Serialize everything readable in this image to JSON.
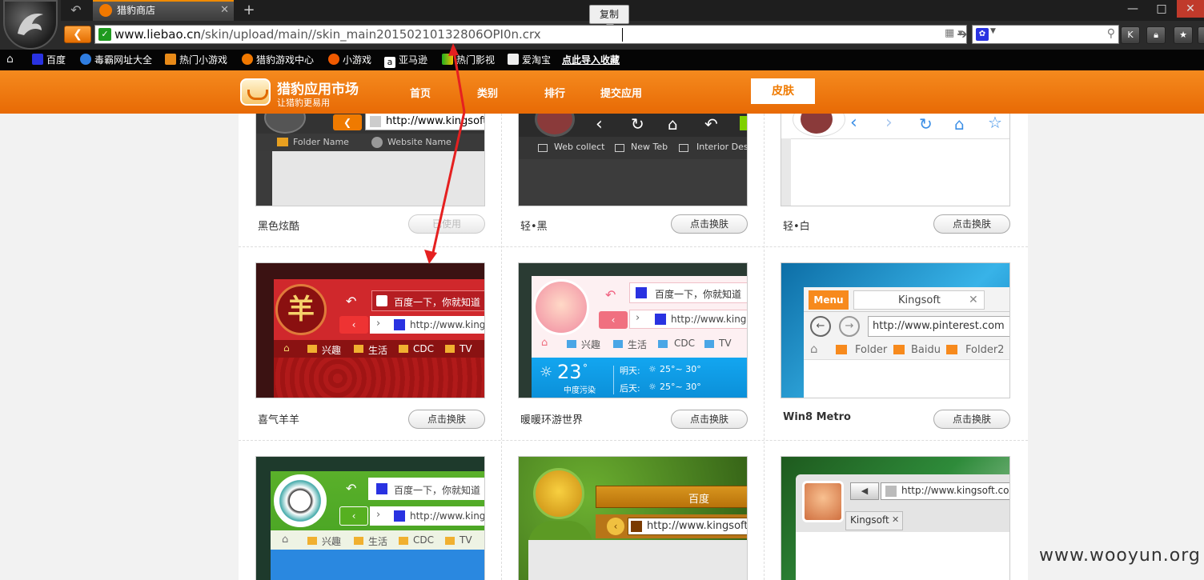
{
  "browser": {
    "tab_title": "猎豹商店",
    "tooltip": "复制",
    "url_domain": "www.liebao.cn",
    "url_path": "/skin/upload/main//skin_main20150210132806OPI0n.crx",
    "bookmarks": [
      "百度",
      "毒霸网址大全",
      "热门小游戏",
      "猎豹游戏中心",
      "小游戏",
      "亚马逊",
      "热门影视",
      "爱淘宝",
      "点此导入收藏"
    ],
    "toolbar_buttons": [
      "K"
    ],
    "colors": {
      "accent": "#f08a00",
      "chrome": "#2b2b2b"
    }
  },
  "site": {
    "name": "猎豹应用市场",
    "slogan": "让猎豹更易用",
    "nav": [
      "首页",
      "类别",
      "排行",
      "提交应用"
    ],
    "skin_button": "皮肤",
    "accent": "#ef7a00"
  },
  "skins": [
    {
      "name": "黑色炫酷",
      "button": "已使用"
    },
    {
      "name": "轻•黑",
      "button": "点击换肤"
    },
    {
      "name": "轻•白",
      "button": "点击换肤"
    },
    {
      "name": "喜气羊羊",
      "button": "点击换肤"
    },
    {
      "name": "暖暖环游世界",
      "button": "点击换肤"
    },
    {
      "name": "Win8 Metro",
      "button": "点击换肤"
    }
  ],
  "thumbs": {
    "t1": {
      "url": "http://www.kingsoft.co",
      "folder": "Folder Name",
      "site": "Website Name"
    },
    "t2": {
      "items": [
        "Web collect",
        "New Teb",
        "Interior Desi"
      ]
    },
    "t4": {
      "search": "百度一下，你就知道",
      "url": "http://www.kings",
      "bookmarks": [
        "兴趣",
        "生活",
        "CDC",
        "TV"
      ]
    },
    "t5": {
      "search": "百度一下，你就知道",
      "url": "http://www.kingso",
      "bookmarks": [
        "兴趣",
        "生活",
        "CDC",
        "TV"
      ],
      "temp": "23",
      "pollution": "中度污染",
      "tomorrow_label": "明天:",
      "tomorrow": "25°~ 30°",
      "after_label": "后天:",
      "after": "25°~ 30°"
    },
    "t6": {
      "menu": "Menu",
      "tab": "Kingsoft",
      "url": "http://www.pinterest.com",
      "folders": [
        "Folder",
        "Baidu",
        "Folder2"
      ]
    },
    "t7": {
      "search": "百度一下，你就知道",
      "url": "http://www.kings",
      "bookmarks": [
        "兴趣",
        "生活",
        "CDC",
        "TV"
      ]
    },
    "t8": {
      "title": "百度",
      "url": "http://www.kingsoft.co"
    },
    "t9": {
      "url": "http://www.kingsoft.com",
      "tab": "Kingsoft"
    }
  },
  "watermark": "www.wooyun.org"
}
